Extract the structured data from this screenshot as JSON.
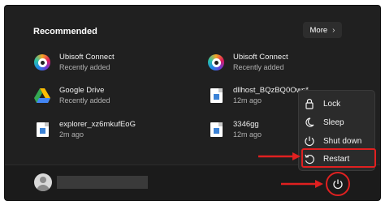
{
  "recommended": {
    "title": "Recommended",
    "more_label": "More",
    "items": [
      {
        "name": "Ubisoft Connect",
        "sub": "Recently added",
        "icon": "ubisoft-connect-icon"
      },
      {
        "name": "Ubisoft Connect",
        "sub": "Recently added",
        "icon": "ubisoft-connect-icon"
      },
      {
        "name": "Google Drive",
        "sub": "Recently added",
        "icon": "google-drive-icon"
      },
      {
        "name": "dllhost_BQzBQ0Ows*",
        "sub": "12m ago",
        "icon": "image-file-icon"
      },
      {
        "name": "explorer_xz6mkufEoG",
        "sub": "2m ago",
        "icon": "image-file-icon"
      },
      {
        "name": "3346gg",
        "sub": "12m ago",
        "icon": "image-file-icon"
      }
    ]
  },
  "power_menu": {
    "items": [
      {
        "label": "Lock",
        "icon": "lock-icon"
      },
      {
        "label": "Sleep",
        "icon": "moon-icon"
      },
      {
        "label": "Shut down",
        "icon": "power-icon"
      },
      {
        "label": "Restart",
        "icon": "restart-icon"
      }
    ]
  },
  "colors": {
    "background": "#202020",
    "annotation": "#e02020"
  }
}
